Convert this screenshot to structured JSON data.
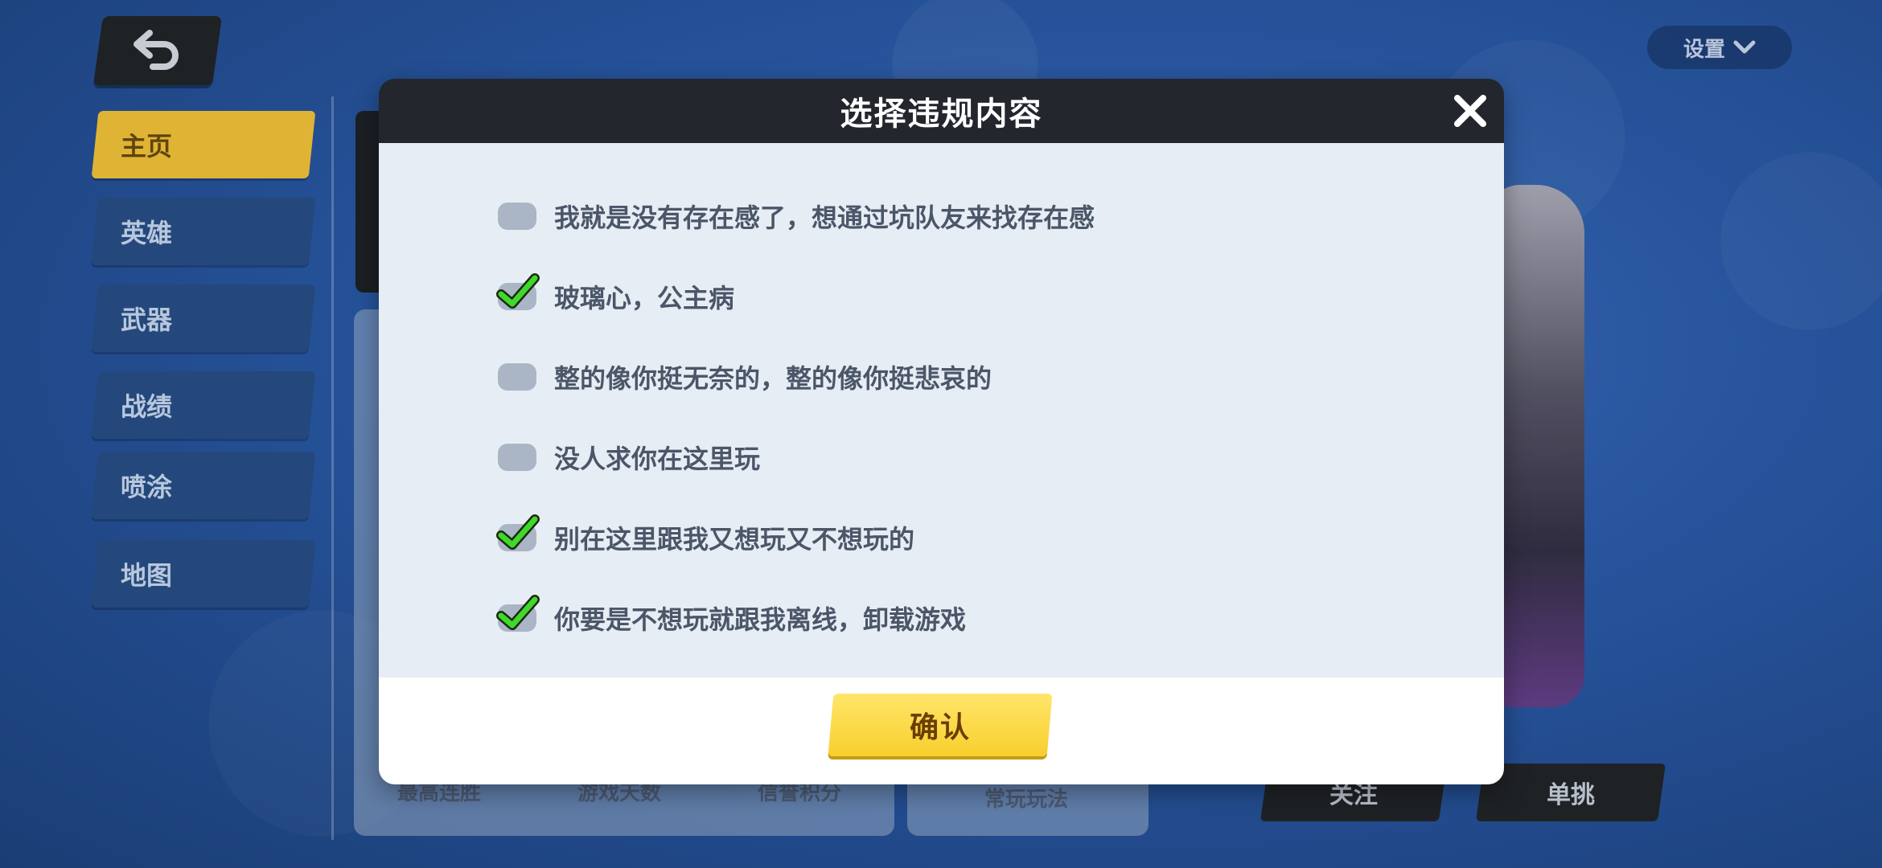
{
  "nav": {
    "back_icon": "back-arrow-icon",
    "settings_label": "设置",
    "settings_icon": "chevron-down-icon"
  },
  "sidebar": {
    "items": [
      {
        "label": "主页",
        "active": true
      },
      {
        "label": "英雄",
        "active": false
      },
      {
        "label": "武器",
        "active": false
      },
      {
        "label": "战绩",
        "active": false
      },
      {
        "label": "喷涂",
        "active": false
      },
      {
        "label": "地图",
        "active": false
      }
    ]
  },
  "background_page": {
    "stats": [
      "最高连胜",
      "游戏天数",
      "信誉积分",
      "常玩玩法"
    ],
    "follow_label": "关注",
    "challenge_label": "单挑"
  },
  "modal": {
    "title": "选择违规内容",
    "close_icon": "close-icon",
    "options": [
      {
        "label": "我就是没有存在感了，想通过坑队友来找存在感",
        "checked": false
      },
      {
        "label": "玻璃心，公主病",
        "checked": true
      },
      {
        "label": "整的像你挺无奈的，整的像你挺悲哀的",
        "checked": false
      },
      {
        "label": "没人求你在这里玩",
        "checked": false
      },
      {
        "label": "别在这里跟我又想玩又不想玩的",
        "checked": true
      },
      {
        "label": "你要是不想玩就跟我离线，卸载游戏",
        "checked": true
      }
    ],
    "confirm_label": "确认"
  },
  "colors": {
    "accent": "#f8cf2d",
    "check_green": "#3fd82b",
    "header_dark": "#23262d",
    "body_bg": "#e7edf4"
  }
}
